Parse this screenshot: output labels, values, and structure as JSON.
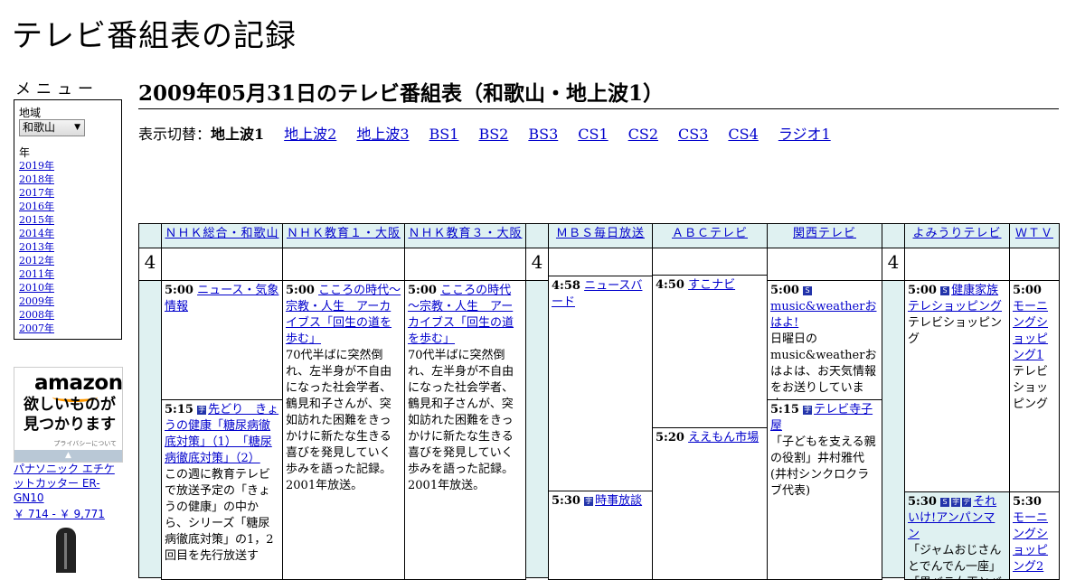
{
  "site_title": "テレビ番組表の記録",
  "menu": {
    "title": "メニュー",
    "region_label": "地域",
    "region_value": "和歌山",
    "year_label": "年",
    "years": [
      "2019年",
      "2018年",
      "2017年",
      "2016年",
      "2015年",
      "2014年",
      "2013年",
      "2012年",
      "2011年",
      "2010年",
      "2009年",
      "2008年",
      "2007年"
    ]
  },
  "ad": {
    "logo": "amazon",
    "tagline1": "欲しいものが",
    "tagline2": "見つかります",
    "privacy": "プライバシーについて",
    "product_name": "パナソニック エチケットカッター ER-GN10",
    "product_price": "￥ 714 - ￥ 9,771"
  },
  "page_heading": "2009年05月31日のテレビ番組表（和歌山・地上波1）",
  "switcher": {
    "label": "表示切替：",
    "current": "地上波1",
    "links": [
      "地上波2",
      "地上波3",
      "BS1",
      "BS2",
      "BS3",
      "CS1",
      "CS2",
      "CS3",
      "CS4",
      "ラジオ1"
    ]
  },
  "channels": [
    "ＮＨＫ総合・和歌山",
    "ＮＨＫ教育１・大阪",
    "ＮＨＫ教育３・大阪",
    "ＭＢＳ毎日放送",
    "ＡＢＣテレビ",
    "関西テレビ",
    "よみうりテレビ",
    "ＷＴＶ"
  ],
  "hour": "4",
  "programs": {
    "nhk1_a": {
      "time": "5:00",
      "title": "ニュース・気象情報"
    },
    "nhk1_b": {
      "time": "5:15",
      "title": "先どり　きょうの健康「糖尿病徹底対策」（1）　「糖尿病徹底対策」（2）",
      "desc": "この週に教育テレビで放送予定の「きょうの健康」の中から、シリーズ「糖尿病徹底対策」の1，2回目を先行放送す"
    },
    "etv1": {
      "time": "5:00",
      "title": "こころの時代～宗教・人生　アーカイブス「回生の道を歩む」",
      "desc": "70代半ばに突然倒れ、左半身が不自由になった社会学者、鶴見和子さんが、突如訪れた困難をきっかけに新たな生きる喜びを発見していく歩みを語った記録。2001年放送。"
    },
    "etv3": {
      "time": "5:00",
      "title": "こころの時代～宗教・人生　アーカイブス「回生の道を歩む」",
      "desc": "70代半ばに突然倒れ、左半身が不自由になった社会学者、鶴見和子さんが、突如訪れた困難をきっかけに新たな生きる喜びを発見していく歩みを語った記録。2001年放送。"
    },
    "mbs_a": {
      "time": "4:58",
      "title": "ニュースバード"
    },
    "mbs_b": {
      "time": "5:30",
      "title": "時事放談"
    },
    "abc_a": {
      "time": "4:50",
      "title": "すこナビ"
    },
    "abc_b": {
      "time": "5:20",
      "title": "ええもん市場"
    },
    "ktv_a": {
      "time": "5:00",
      "title": "music&weatherおはよ!",
      "desc": "日曜日のmusic&weatherおはよは、お天気情報をお送りしています。"
    },
    "ktv_b": {
      "time": "5:15",
      "title": "テレビ寺子屋",
      "desc": "「子どもを支える親の役割」井村雅代(井村シンクロクラブ代表)"
    },
    "ytv_a": {
      "time": "5:00",
      "title": "健康家族テレショッピング",
      "desc": "テレビショッピング"
    },
    "ytv_b": {
      "time": "5:30",
      "title": "それいけ!アンパンマン",
      "desc": "「ジャムおじさんとでんでん一座」「黒バラ女王とバ"
    },
    "wtv_a": {
      "time": "5:00",
      "title": "モーニングショッピング1",
      "desc": "テレビショッピング"
    },
    "wtv_b": {
      "time": "5:30",
      "title": "モーニングショッピング2"
    }
  }
}
